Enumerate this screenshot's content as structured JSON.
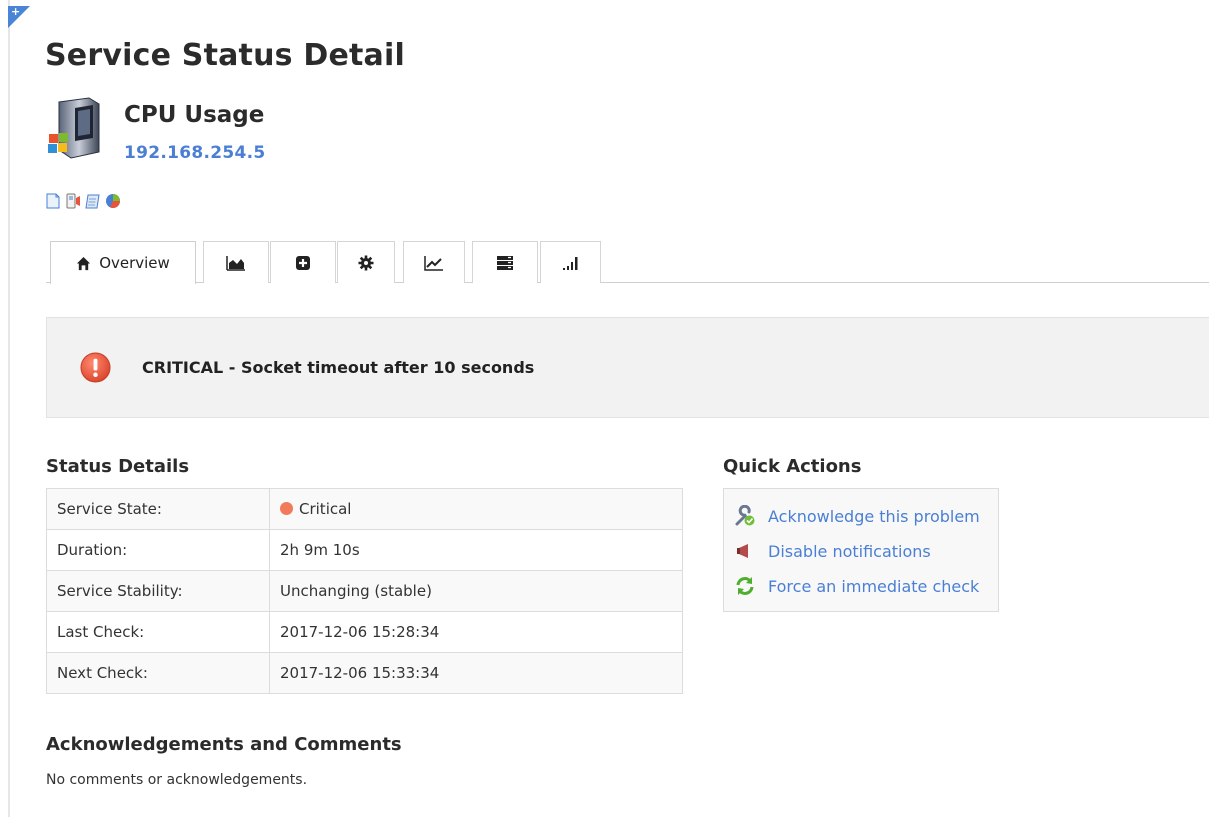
{
  "page": {
    "title": "Service Status Detail",
    "corner_icon": "plus-icon",
    "corner_glyph": "+"
  },
  "service": {
    "name": "CPU Usage",
    "host": "192.168.254.5",
    "icon": "server-icon"
  },
  "mini_actions": [
    "document-icon",
    "phone-icon",
    "notes-icon",
    "pie-chart-icon"
  ],
  "tabs": [
    {
      "name": "overview",
      "label": "Overview",
      "icon": "home-icon",
      "active": true
    },
    {
      "name": "graph",
      "label": "",
      "icon": "area-chart-icon"
    },
    {
      "name": "add",
      "label": "",
      "icon": "plus-square-icon"
    },
    {
      "name": "settings",
      "label": "",
      "icon": "gear-icon"
    },
    {
      "name": "trend",
      "label": "",
      "icon": "line-chart-icon"
    },
    {
      "name": "list",
      "label": "",
      "icon": "list-icon"
    },
    {
      "name": "signal",
      "label": "",
      "icon": "signal-bars-icon"
    }
  ],
  "alert": {
    "state": "CRITICAL",
    "text": "CRITICAL - Socket timeout after 10 seconds",
    "color": "#e8533a"
  },
  "status_details": {
    "heading": "Status Details",
    "rows": [
      {
        "label": "Service State:",
        "value": "Critical",
        "badge_color": "#f07a5a"
      },
      {
        "label": "Duration:",
        "value": "2h 9m 10s"
      },
      {
        "label": "Service Stability:",
        "value": "Unchanging (stable)"
      },
      {
        "label": "Last Check:",
        "value": "2017-12-06 15:28:34"
      },
      {
        "label": "Next Check:",
        "value": "2017-12-06 15:33:34"
      }
    ]
  },
  "quick_actions": {
    "heading": "Quick Actions",
    "items": [
      {
        "label": "Acknowledge this problem",
        "icon": "wrench-check-icon"
      },
      {
        "label": "Disable notifications",
        "icon": "megaphone-mute-icon"
      },
      {
        "label": "Force an immediate check",
        "icon": "refresh-icon"
      }
    ]
  },
  "comments": {
    "heading": "Acknowledgements and Comments",
    "text": "No comments or acknowledgements."
  },
  "colors": {
    "accent": "#4a7fd4",
    "critical": "#f07a5a"
  }
}
